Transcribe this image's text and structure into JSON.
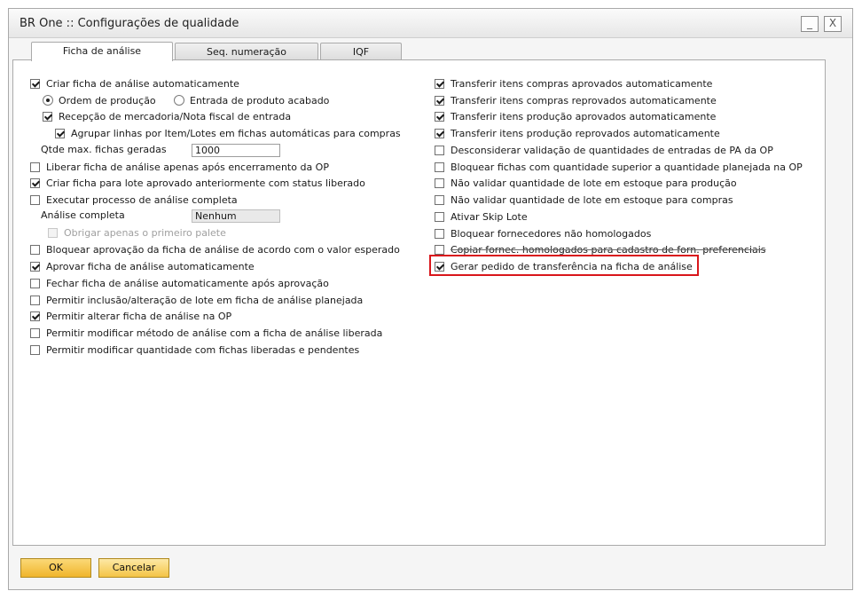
{
  "window": {
    "title": "BR One :: Configurações de qualidade"
  },
  "title_buttons": {
    "minimize": "_",
    "close": "X"
  },
  "tabs": [
    {
      "label": "Ficha de análise",
      "active": true
    },
    {
      "label": "Seq. numeração",
      "active": false
    },
    {
      "label": "IQF",
      "active": false
    }
  ],
  "left": {
    "criar_auto": {
      "label": "Criar ficha de análise automaticamente",
      "checked": true
    },
    "radio_producao": {
      "label": "Ordem de produção",
      "selected": true
    },
    "radio_entrada": {
      "label": "Entrada de produto acabado",
      "selected": false
    },
    "recepcao": {
      "label": "Recepção de mercadoria/Nota fiscal de entrada",
      "checked": true
    },
    "agrupar": {
      "label": "Agrupar linhas por Item/Lotes em fichas automáticas para compras",
      "checked": true
    },
    "qtde_label": "Qtde max. fichas geradas",
    "qtde_value": "1000",
    "liberar": {
      "label": "Liberar ficha de análise apenas após encerramento da OP",
      "checked": false
    },
    "criar_lote": {
      "label": "Criar ficha para lote aprovado anteriormente com status liberado",
      "checked": true
    },
    "executar": {
      "label": "Executar processo de análise completa",
      "checked": false
    },
    "analise_label": "Análise completa",
    "analise_value": "Nenhum",
    "obrigar": {
      "label": "Obrigar apenas o primeiro palete",
      "checked": false
    },
    "bloquear_aprov": {
      "label": "Bloquear aprovação da ficha de análise de acordo com o valor esperado",
      "checked": false
    },
    "aprovar_auto": {
      "label": "Aprovar ficha de análise automaticamente",
      "checked": true
    },
    "fechar_auto": {
      "label": "Fechar ficha de análise automaticamente após aprovação",
      "checked": false
    },
    "permitir_inclusao": {
      "label": "Permitir inclusão/alteração de lote em ficha de análise planejada",
      "checked": false
    },
    "permitir_alterar": {
      "label": "Permitir alterar ficha de análise na OP",
      "checked": true
    },
    "permitir_metodo": {
      "label": "Permitir modificar método de análise com a ficha de análise liberada",
      "checked": false
    },
    "permitir_qtd": {
      "label": "Permitir modificar quantidade com fichas liberadas e pendentes",
      "checked": false
    }
  },
  "right": {
    "items": [
      {
        "label": "Transferir itens compras aprovados automaticamente",
        "checked": true
      },
      {
        "label": "Transferir itens compras reprovados automaticamente",
        "checked": true
      },
      {
        "label": "Transferir itens produção aprovados automaticamente",
        "checked": true
      },
      {
        "label": "Transferir itens produção reprovados automaticamente",
        "checked": true
      },
      {
        "label": "Desconsiderar validação de quantidades de entradas de PA da OP",
        "checked": false
      },
      {
        "label": "Bloquear fichas com quantidade superior a quantidade planejada na OP",
        "checked": false
      },
      {
        "label": "Não validar quantidade de lote em estoque para produção",
        "checked": false
      },
      {
        "label": "Não validar quantidade de lote em estoque para compras",
        "checked": false
      },
      {
        "label": "Ativar Skip Lote",
        "checked": false
      },
      {
        "label": "Bloquear fornecedores não homologados",
        "checked": false
      },
      {
        "label": "Copiar fornec. homologados para cadastro de forn. preferenciais",
        "checked": false
      },
      {
        "label": "Gerar pedido de transferência na ficha de análise",
        "checked": true
      }
    ]
  },
  "footer": {
    "ok_label": "OK",
    "cancel_label": "Cancelar"
  },
  "colors": {
    "highlight": "#d9161b",
    "button": "#f4c446"
  }
}
